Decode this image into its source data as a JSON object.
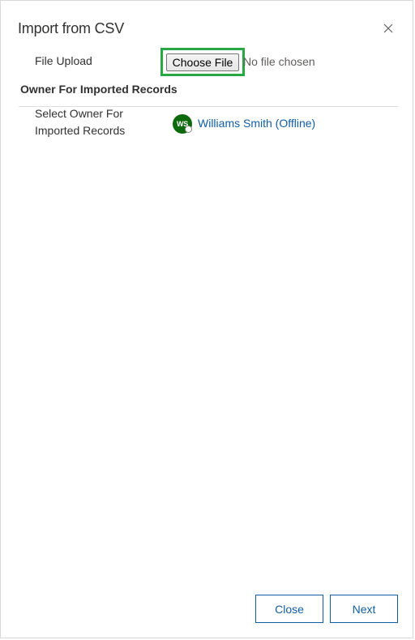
{
  "dialog": {
    "title": "Import from CSV",
    "close_icon": "close-icon"
  },
  "file_upload": {
    "label": "File Upload",
    "button_label": "Choose File",
    "status": "No file chosen",
    "highlight_color": "#27a844"
  },
  "owner_section": {
    "heading": "Owner For Imported Records",
    "field_label": "Select Owner For Imported Records",
    "owner": {
      "initials": "WS",
      "name": "Williams Smith (Offline)",
      "avatar_color": "#0b6a0b",
      "presence_icon": "offline-presence-icon"
    }
  },
  "footer": {
    "close_label": "Close",
    "next_label": "Next"
  },
  "colors": {
    "accent": "#115ea3",
    "text": "#323130"
  }
}
